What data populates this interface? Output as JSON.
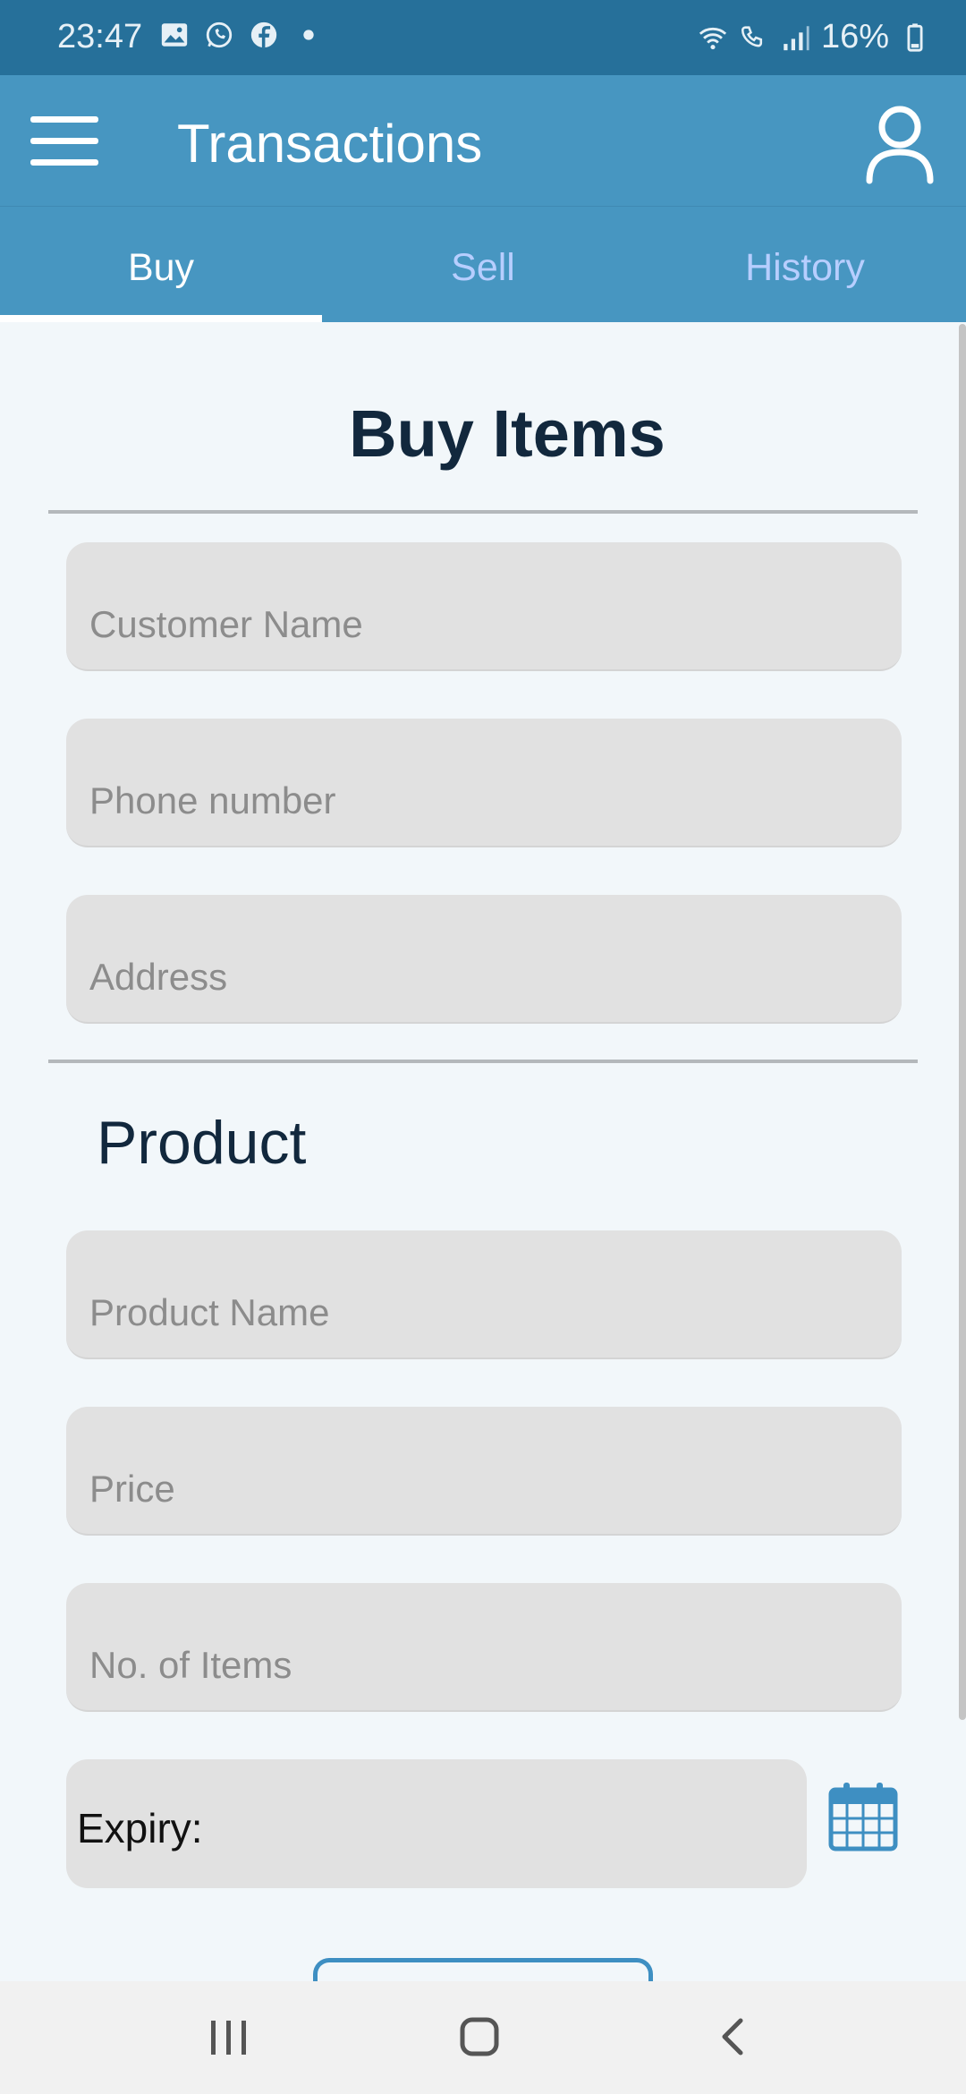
{
  "status_bar": {
    "time": "23:47",
    "battery": "16%",
    "left_icons": [
      "gallery-icon",
      "whatsapp-icon",
      "facebook-icon",
      "dot-icon"
    ],
    "right_icons": [
      "wifi-icon",
      "wifi-calling-icon",
      "signal-icon",
      "battery-icon"
    ]
  },
  "app_bar": {
    "title": "Transactions"
  },
  "tabs": [
    {
      "label": "Buy",
      "active": true
    },
    {
      "label": "Sell",
      "active": false
    },
    {
      "label": "History",
      "active": false
    }
  ],
  "form": {
    "heading": "Buy Items",
    "customer_fields": [
      {
        "placeholder": "Customer Name"
      },
      {
        "placeholder": "Phone number"
      },
      {
        "placeholder": "Address"
      }
    ],
    "product_section_title": "Product",
    "product_fields": [
      {
        "placeholder": "Product Name"
      },
      {
        "placeholder": "Price"
      },
      {
        "placeholder": "No. of Items"
      }
    ],
    "expiry_label": "Expiry:"
  },
  "colors": {
    "status_bar": "#26709a",
    "app_bar": "#4796c1",
    "active_tab": "#ffffff",
    "inactive_tab": "#b7ceff",
    "heading": "#12283d",
    "field_bg": "#e1e1e1",
    "accent": "#3e8fc2"
  }
}
